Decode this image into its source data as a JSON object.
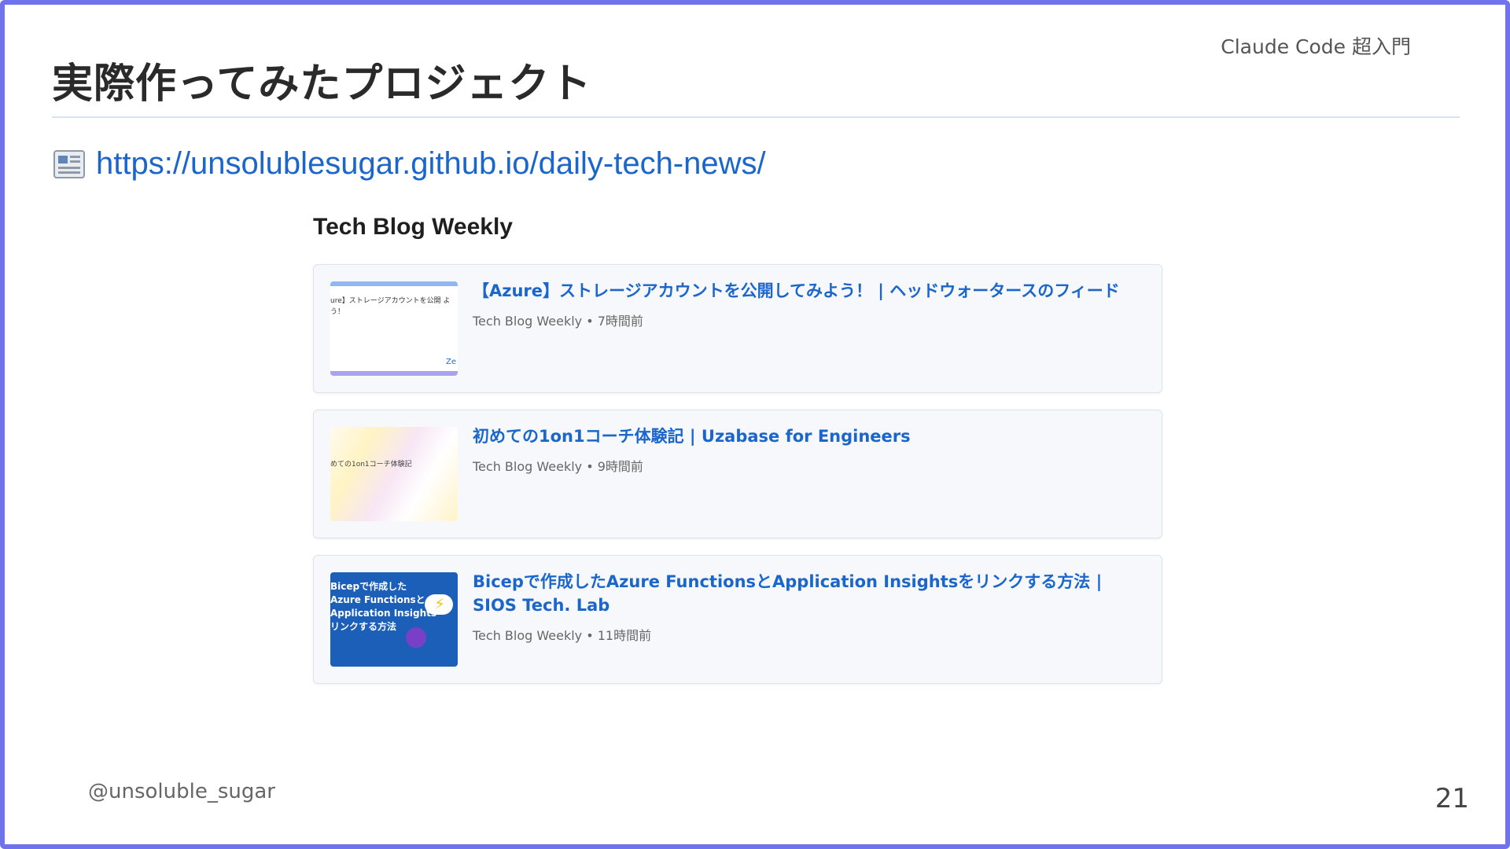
{
  "header": {
    "label": "Claude Code 超入門"
  },
  "slide": {
    "title": "実際作ってみたプロジェクト",
    "url_icon": "newspaper-icon",
    "url": "https://unsolublesugar.github.io/daily-tech-news/"
  },
  "site": {
    "title": "Tech Blog Weekly",
    "articles": [
      {
        "title": "【Azure】ストレージアカウントを公開してみよう！ | ヘッドウォータースのフィード",
        "meta": "Tech Blog Weekly • 7時間前",
        "thumb_text": "ure】ストレージアカウントを公開 よう！",
        "thumb_foot": "Ze"
      },
      {
        "title": "初めての1on1コーチ体験記 | Uzabase for Engineers",
        "meta": "Tech Blog Weekly • 9時間前",
        "thumb_text": "めての1on1コーチ体験記"
      },
      {
        "title": "Bicepで作成したAzure FunctionsとApplication Insightsをリンクする方法 | SIOS Tech. Lab",
        "meta": "Tech Blog Weekly • 11時間前",
        "thumb_text": "Bicepで作成した Azure Functionsと Application Insights リンクする方法"
      }
    ]
  },
  "footer": {
    "author": "@unsoluble_sugar",
    "page_number": "21"
  },
  "colors": {
    "frame": "#6f73ec",
    "link": "#1a66cc",
    "card_bg": "#f6f8fb"
  }
}
